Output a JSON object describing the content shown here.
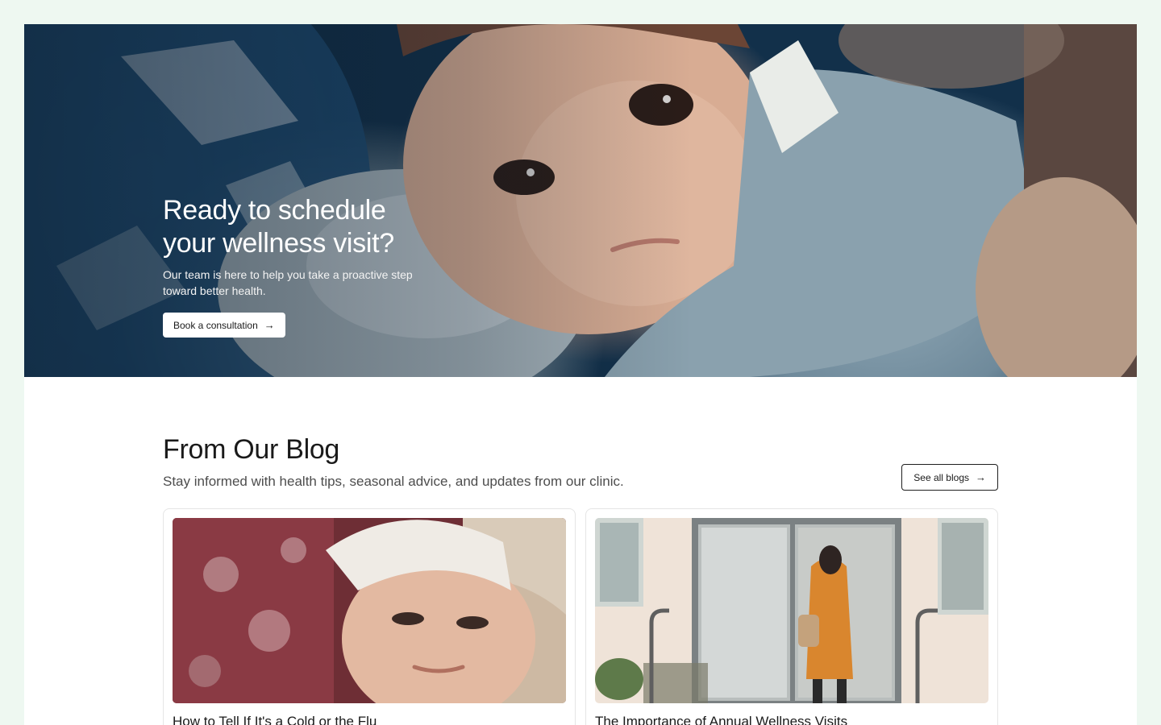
{
  "hero": {
    "title_line1": "Ready to schedule",
    "title_line2": "your wellness visit?",
    "subtitle": "Our team is here to help you take a proactive step toward better health.",
    "cta_label": "Book a consultation",
    "cta_icon": "arrow-right-icon"
  },
  "blog": {
    "title": "From Our Blog",
    "subtitle": "Stay informed with health tips, seasonal advice, and updates from our clinic.",
    "see_all_label": "See all blogs",
    "see_all_icon": "arrow-right-icon",
    "posts": [
      {
        "title": "How to Tell If It's a Cold or the Flu"
      },
      {
        "title": "The Importance of Annual Wellness Visits"
      }
    ]
  },
  "colors": {
    "page_background": "#eef8f1",
    "content_background": "#ffffff",
    "button_background": "#ffffff",
    "text_primary": "#1a1a1a"
  }
}
